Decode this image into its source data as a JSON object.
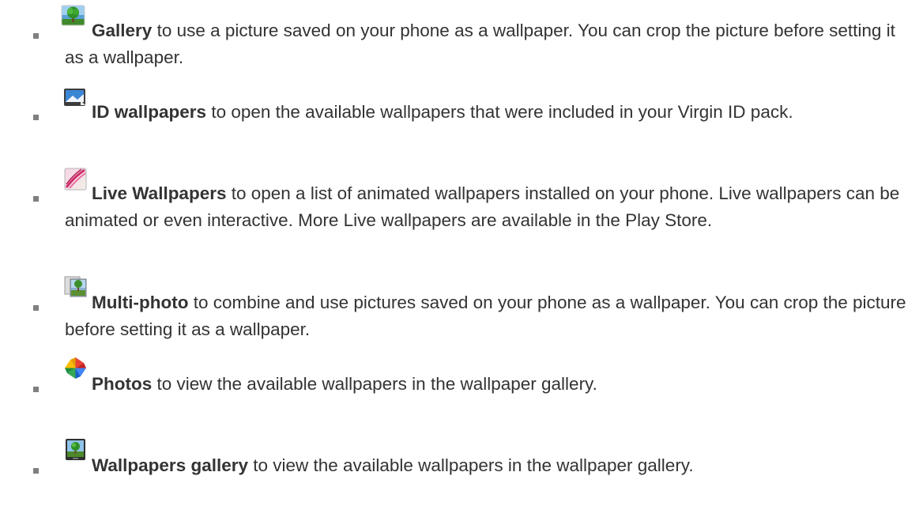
{
  "items": [
    {
      "icon": "gallery-tree-icon",
      "title": "Gallery",
      "body": " to use a picture saved on your phone as a wallpaper. You can crop the picture before setting it as a wallpaper."
    },
    {
      "icon": "id-wallpapers-icon",
      "title": "ID wallpapers",
      "body": " to open the available wallpapers that were included in your Virgin ID pack."
    },
    {
      "icon": "live-wallpapers-icon",
      "title": "Live Wallpapers",
      "body": " to open a list of animated wallpapers installed on your phone. Live wallpapers can be animated or even interactive. More Live wallpapers are available in the Play Store."
    },
    {
      "icon": "multi-photo-icon",
      "title": "Multi-photo",
      "body": " to combine and use pictures saved on your phone as a wallpaper. You can crop the picture before setting it as a wallpaper."
    },
    {
      "icon": "photos-pinwheel-icon",
      "title": "Photos",
      "body": " to view the available wallpapers in the wallpaper gallery."
    },
    {
      "icon": "wallpapers-gallery-icon",
      "title": "Wallpapers gallery",
      "body": " to view the available wallpapers in the wallpaper gallery."
    }
  ],
  "colors": {
    "text": "#333333",
    "bullet": "#808080"
  }
}
